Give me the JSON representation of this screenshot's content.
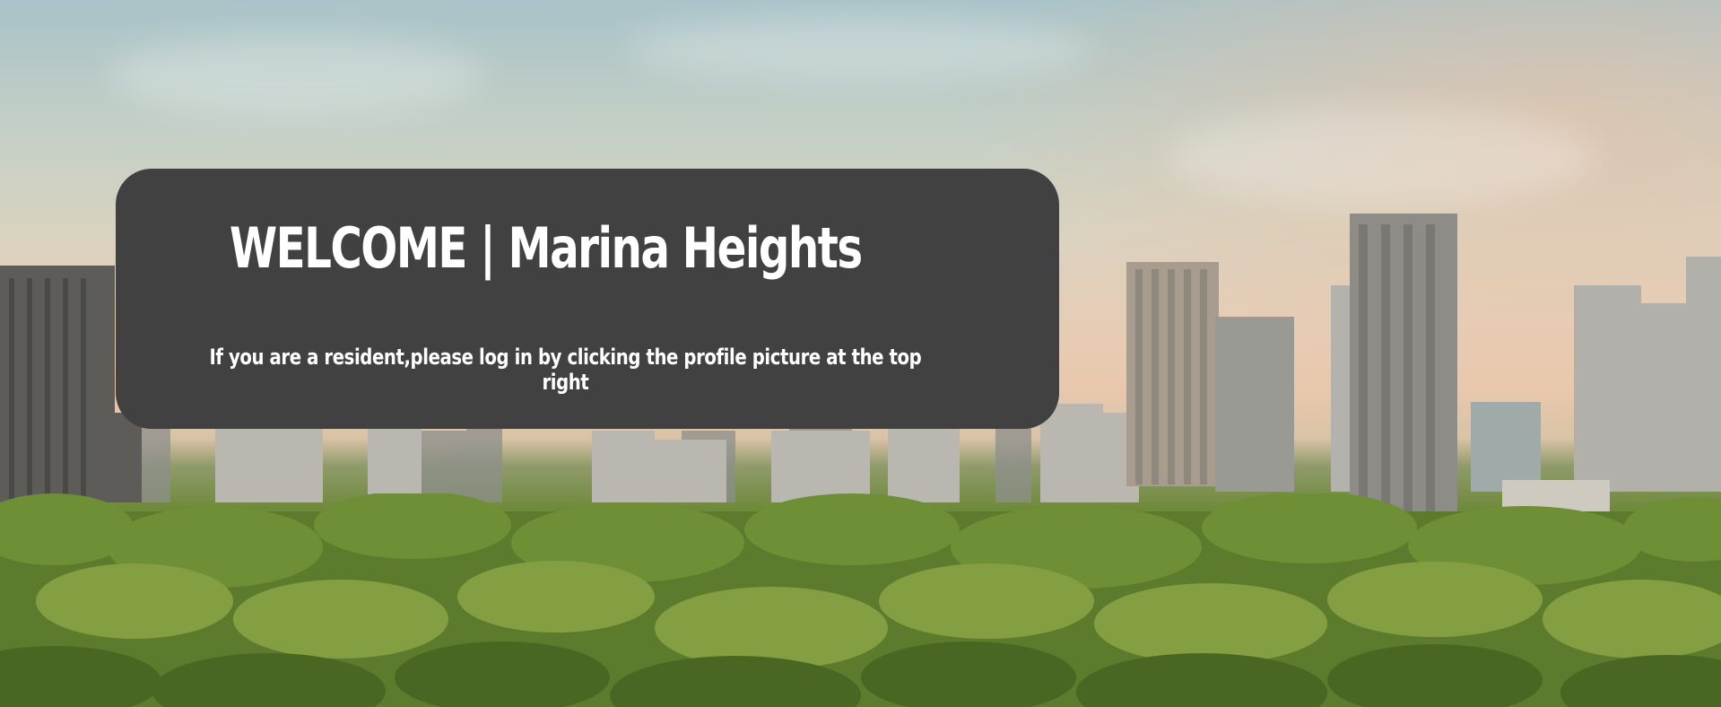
{
  "hero": {
    "title": "WELCOME | Marina Heights",
    "subtitle": "If you are a resident,please log in by clicking the profile picture at the top right"
  },
  "colors": {
    "card_background": "#414141",
    "card_text": "#ffffff",
    "foliage": "#5a7a2b",
    "sky": "#c3cfc6"
  }
}
